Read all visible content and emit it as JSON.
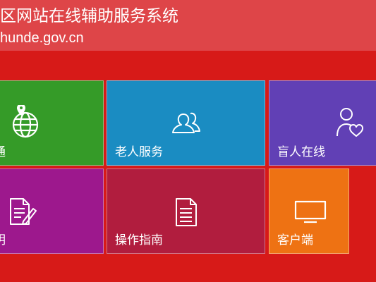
{
  "header": {
    "title": "区网站在线辅助服务系统",
    "domain": "hunde.gov.cn"
  },
  "tiles": [
    {
      "label": "通",
      "icon": "globe-location-icon",
      "color": "#359b28"
    },
    {
      "label": "老人服务",
      "icon": "users-icon",
      "color": "#1a8cc2"
    },
    {
      "label": "盲人在线",
      "icon": "user-heart-icon",
      "color": "#6140b5"
    },
    {
      "label": "明",
      "icon": "document-edit-icon",
      "color": "#9d188d"
    },
    {
      "label": "操作指南",
      "icon": "document-icon",
      "color": "#b11d3e"
    },
    {
      "label": "客户端",
      "icon": "monitor-icon",
      "color": "#ee7213"
    }
  ]
}
